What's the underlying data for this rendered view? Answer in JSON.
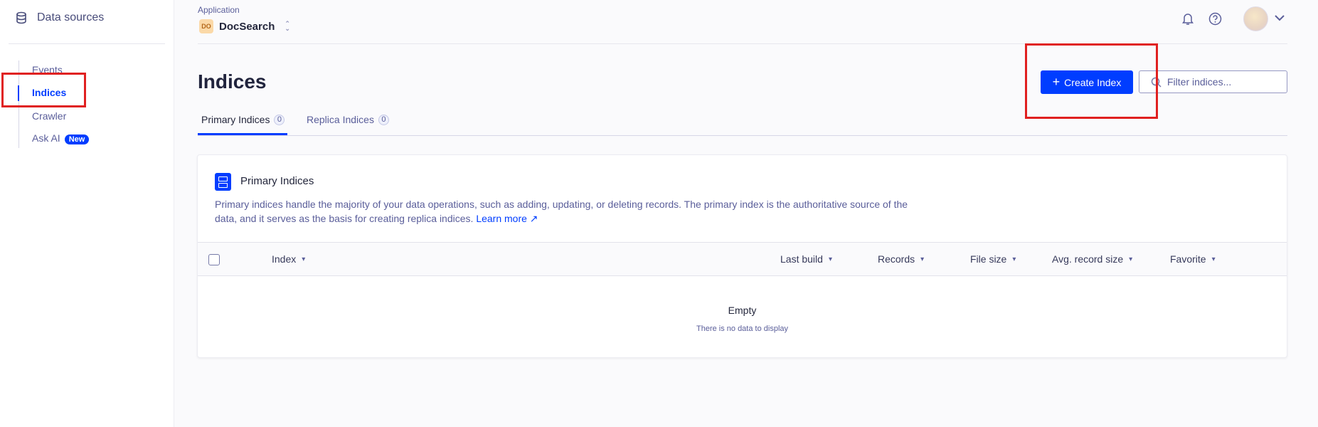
{
  "sidebar": {
    "title": "Data sources",
    "items": [
      {
        "label": "Events"
      },
      {
        "label": "Indices"
      },
      {
        "label": "Crawler"
      },
      {
        "label": "Ask AI",
        "badge": "New"
      }
    ]
  },
  "header": {
    "application_label": "Application",
    "app_badge": "DO",
    "app_name": "DocSearch"
  },
  "page": {
    "title": "Indices",
    "create_button": "Create Index",
    "filter_placeholder": "Filter indices...",
    "tabs": [
      {
        "label": "Primary Indices",
        "count": "0"
      },
      {
        "label": "Replica Indices",
        "count": "0"
      }
    ]
  },
  "card": {
    "title": "Primary Indices",
    "description": "Primary indices handle the majority of your data operations, such as adding, updating, or deleting records. The primary index is the authoritative source of the data, and it serves as the basis for creating replica indices.",
    "learn_more": "Learn more",
    "columns": [
      "Index",
      "Last build",
      "Records",
      "File size",
      "Avg. record size",
      "Favorite"
    ],
    "empty_title": "Empty",
    "empty_subtitle": "There is no data to display"
  },
  "colors": {
    "accent": "#003dff",
    "highlight": "#e02020"
  }
}
